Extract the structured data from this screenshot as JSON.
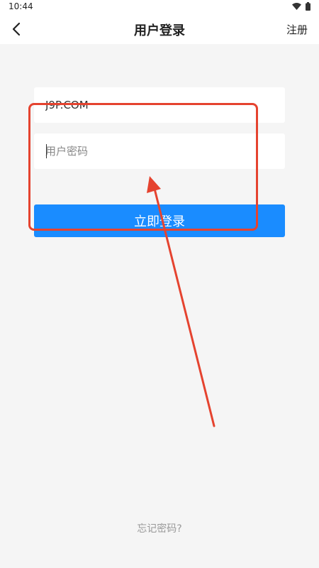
{
  "status": {
    "time": "10:44"
  },
  "header": {
    "title": "用户登录",
    "register_label": "注册"
  },
  "form": {
    "username_value": "J9P.COM",
    "password_placeholder": "用户密码",
    "login_label": "立即登录"
  },
  "footer": {
    "forgot_label": "忘记密码?"
  },
  "colors": {
    "accent": "#1a8cff",
    "annotation": "#e5432f",
    "background": "#f5f5f5"
  }
}
